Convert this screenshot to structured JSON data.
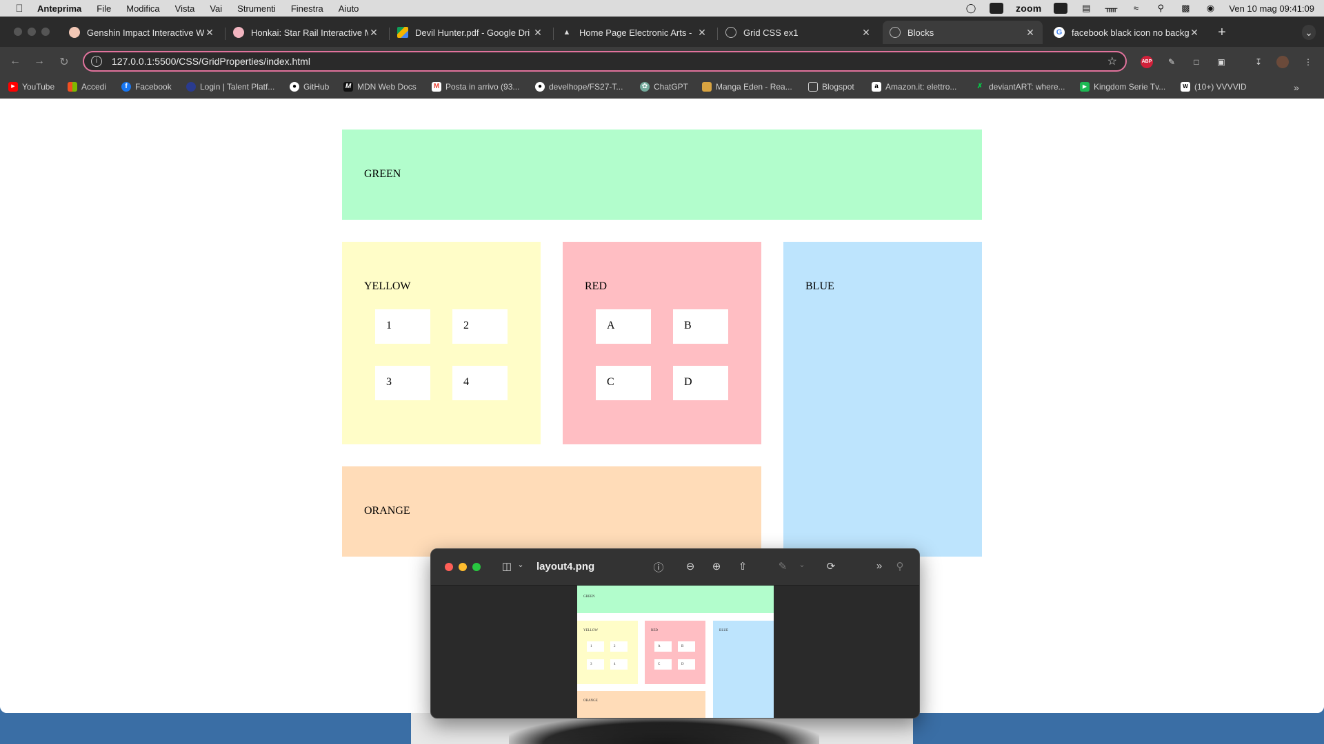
{
  "menubar": {
    "app": "Anteprima",
    "items": [
      "File",
      "Modifica",
      "Vista",
      "Vai",
      "Strumenti",
      "Finestra",
      "Aiuto"
    ],
    "zoom": "zoom",
    "datetime": "Ven 10 mag  09:41:09"
  },
  "tabs": [
    {
      "label": "Genshin Impact Interactive W",
      "icon": "genshin-icon",
      "color": "#f2c7b5"
    },
    {
      "label": "Honkai: Star Rail Interactive M",
      "icon": "honkai-icon",
      "color": "#f2b5c0"
    },
    {
      "label": "Devil Hunter.pdf - Google Dri",
      "icon": "google-drive-icon",
      "color": "#f4b400"
    },
    {
      "label": "Home Page Electronic Arts - ",
      "icon": "ea-icon",
      "color": "#cccccc"
    },
    {
      "label": "Grid CSS ex1",
      "icon": "globe-icon",
      "color": "#bbbbbb"
    },
    {
      "label": "Blocks",
      "icon": "globe-icon",
      "color": "#bbbbbb"
    },
    {
      "label": "facebook black icon no backg",
      "icon": "google-icon",
      "color": "#4285f4"
    }
  ],
  "address": {
    "url": "127.0.0.1:5500/CSS/GridProperties/index.html"
  },
  "extensions": {
    "abp": "ABP"
  },
  "bookmarks": [
    {
      "label": "YouTube",
      "icon": "youtube-icon",
      "color": "#ff0000"
    },
    {
      "label": "Accedi",
      "icon": "microsoft-icon",
      "color": "#f25022"
    },
    {
      "label": "Facebook",
      "icon": "facebook-icon",
      "color": "#1877f2"
    },
    {
      "label": "Login | Talent Platf...",
      "icon": "talent-icon",
      "color": "#2a3b8f"
    },
    {
      "label": "GitHub",
      "icon": "github-icon",
      "color": "#ffffff"
    },
    {
      "label": "MDN Web Docs",
      "icon": "mdn-icon",
      "color": "#111111"
    },
    {
      "label": "Posta in arrivo (93...",
      "icon": "gmail-icon",
      "color": "#ea4335"
    },
    {
      "label": "develhope/FS27-T...",
      "icon": "github-icon",
      "color": "#ffffff"
    },
    {
      "label": "ChatGPT",
      "icon": "chatgpt-icon",
      "color": "#74aa9c"
    },
    {
      "label": "Manga Eden - Rea...",
      "icon": "manga-icon",
      "color": "#d9a441"
    },
    {
      "label": "Blogspot",
      "icon": "folder-icon",
      "color": "#cfcfcf"
    },
    {
      "label": "Amazon.it: elettro...",
      "icon": "amazon-icon",
      "color": "#ffffff"
    },
    {
      "label": "deviantART: where...",
      "icon": "deviantart-icon",
      "color": "#05cc47"
    },
    {
      "label": "Kingdom Serie Tv...",
      "icon": "kingdom-icon",
      "color": "#1db954"
    },
    {
      "label": "(10+) VVVVID",
      "icon": "vvvvid-icon",
      "color": "#ffffff"
    }
  ],
  "page": {
    "green": "GREEN",
    "yellow": "YELLOW",
    "red": "RED",
    "blue": "BLUE",
    "orange": "ORANGE",
    "yellow_items": [
      "1",
      "2",
      "3",
      "4"
    ],
    "red_items": [
      "A",
      "B",
      "C",
      "D"
    ],
    "colors": {
      "green": "#b2fdcc",
      "yellow": "#fffdc8",
      "red": "#ffbec3",
      "blue": "#bde4fd",
      "orange": "#ffdcb8"
    }
  },
  "preview": {
    "title": "layout4.png"
  }
}
